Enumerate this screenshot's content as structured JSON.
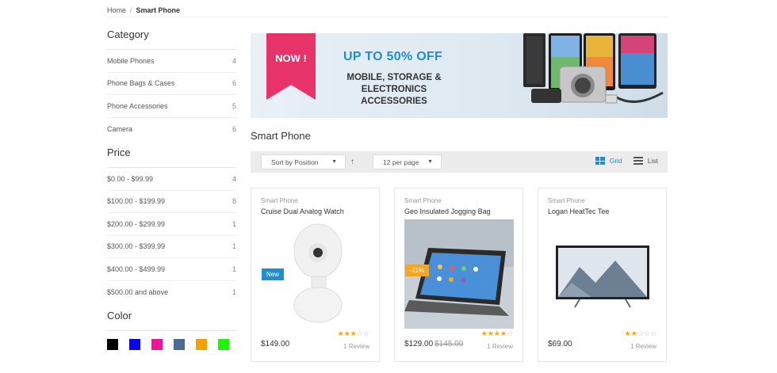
{
  "breadcrumb": {
    "home": "Home",
    "separator": "/",
    "current": "Smart Phone"
  },
  "sidebar": {
    "category": {
      "title": "Category",
      "items": [
        {
          "label": "Mobile Phones",
          "count": "4"
        },
        {
          "label": "Phone Bags & Cases",
          "count": "6"
        },
        {
          "label": "Phone Accessories",
          "count": "5"
        },
        {
          "label": "Camera",
          "count": "6"
        }
      ]
    },
    "price": {
      "title": "Price",
      "items": [
        {
          "label": "$0.00 - $99.99",
          "count": "4"
        },
        {
          "label": "$100.00 - $199.99",
          "count": "8"
        },
        {
          "label": "$200.00 - $299.99",
          "count": "1"
        },
        {
          "label": "$300.00 - $399.99",
          "count": "1"
        },
        {
          "label": "$400.00 - $499.99",
          "count": "1"
        },
        {
          "label": "$500.00 and above",
          "count": "1"
        }
      ]
    },
    "color": {
      "title": "Color",
      "swatches": [
        "#000000",
        "#0a00f5",
        "#f0149b",
        "#4c6a94",
        "#f5a000",
        "#1cf500"
      ]
    }
  },
  "banner": {
    "ribbon": "NOW !",
    "headline": "UP TO 50% OFF",
    "subline1": "MOBILE, STORAGE &",
    "subline2": "ELECTRONICS ACCESSORIES"
  },
  "page_title": "Smart Phone",
  "toolbar": {
    "sort_label": "Sort by Position",
    "sort_dir": "↑",
    "per_page": "12 per page",
    "grid_label": "Grid",
    "list_label": "List"
  },
  "products": [
    {
      "category": "Smart Phone",
      "name": "Cruise Dual Analog Watch",
      "price": "$149.00",
      "old_price": "",
      "badge": "New",
      "rating": 3,
      "reviews": "1 Review"
    },
    {
      "category": "Smart Phone",
      "name": "Geo Insulated Jogging Bag",
      "price": "$129.00",
      "old_price": "$145.00",
      "badge": "-11%",
      "rating": 4,
      "reviews": "1 Review"
    },
    {
      "category": "Smart Phone",
      "name": "Logan HeatTec Tee",
      "price": "$69.00",
      "old_price": "",
      "badge": "",
      "rating": 2,
      "reviews": "1 Review"
    }
  ],
  "colors": {
    "accent": "#1d8fd1",
    "ribbon": "#e8336a",
    "star": "#f5a623"
  }
}
